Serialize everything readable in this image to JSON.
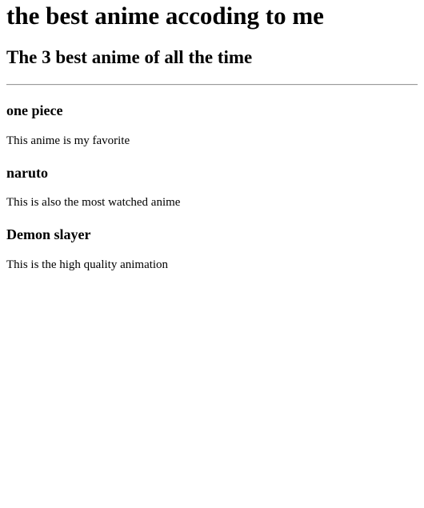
{
  "header": {
    "title": "the best anime accoding to me",
    "subtitle": "The 3 best anime of all the time"
  },
  "anime_list": [
    {
      "title": "one piece",
      "description": "This anime is my favorite"
    },
    {
      "title": "naruto",
      "description": "This is also the most watched anime"
    },
    {
      "title": "Demon slayer",
      "description": "This is the high quality animation"
    }
  ]
}
